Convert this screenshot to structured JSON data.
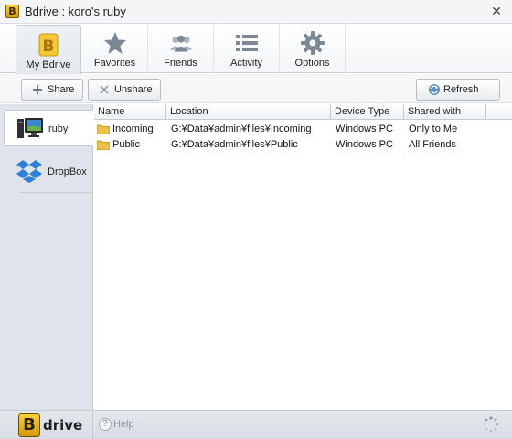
{
  "window": {
    "title": "Bdrive : koro's ruby",
    "app_icon_letter": "B",
    "close_glyph": "✕"
  },
  "tabs": [
    {
      "label": "My Bdrive",
      "icon": "bdrive-icon",
      "active": true
    },
    {
      "label": "Favorites",
      "icon": "star-icon",
      "active": false
    },
    {
      "label": "Friends",
      "icon": "friends-icon",
      "active": false
    },
    {
      "label": "Activity",
      "icon": "list-icon",
      "active": false
    },
    {
      "label": "Options",
      "icon": "gear-icon",
      "active": false
    }
  ],
  "toolbar": {
    "share_label": "Share",
    "unshare_label": "Unshare",
    "refresh_label": "Refresh"
  },
  "sidebar": {
    "items": [
      {
        "label": "ruby",
        "icon": "computer-icon",
        "active": true
      },
      {
        "label": "DropBox",
        "icon": "dropbox-icon",
        "active": false
      }
    ]
  },
  "table": {
    "columns": [
      "Name",
      "Location",
      "Device Type",
      "Shared with"
    ],
    "rows": [
      {
        "name": "Incoming",
        "location": "G:¥Data¥admin¥files¥Incoming",
        "device": "Windows PC",
        "shared": "Only to Me"
      },
      {
        "name": "Public",
        "location": "G:¥Data¥admin¥files¥Public",
        "device": "Windows PC",
        "shared": "All Friends"
      }
    ]
  },
  "footer": {
    "logo_letter": "B",
    "logo_text": "drive",
    "help_label": "Help",
    "help_glyph": "?"
  },
  "colors": {
    "accent_gold": "#e6b31e",
    "sidebar_bg": "#dee4ea",
    "folder": "#e8c04a"
  }
}
